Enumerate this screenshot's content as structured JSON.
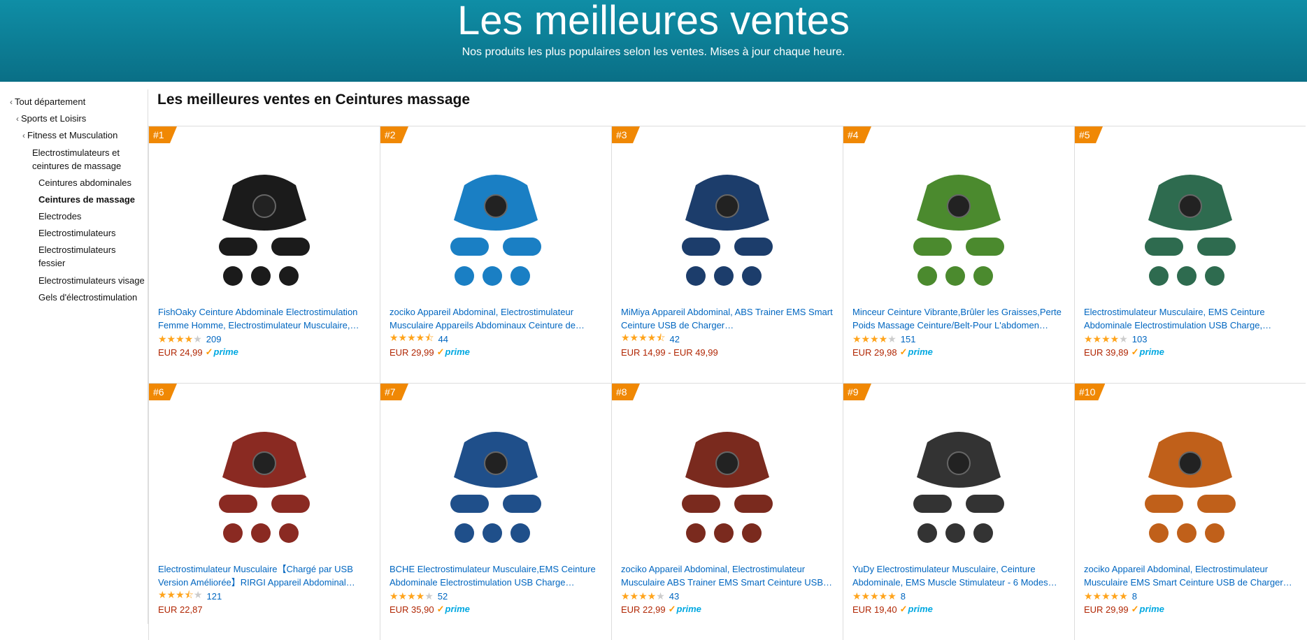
{
  "banner": {
    "title": "Les meilleures ventes",
    "subtitle": "Nos produits les plus populaires selon les ventes. Mises à jour chaque heure."
  },
  "sidebar": {
    "items": [
      {
        "label": "Tout département",
        "chevron": true,
        "bold": false
      },
      {
        "label": "Sports et Loisirs",
        "chevron": true,
        "bold": false
      },
      {
        "label": "Fitness et Musculation",
        "chevron": true,
        "bold": false
      },
      {
        "label": "Electrostimulateurs et ceintures de massage",
        "chevron": false,
        "bold": false
      },
      {
        "label": "Ceintures abdominales",
        "chevron": false,
        "bold": false
      },
      {
        "label": "Ceintures de massage",
        "chevron": false,
        "bold": true
      },
      {
        "label": "Electrodes",
        "chevron": false,
        "bold": false
      },
      {
        "label": "Electrostimulateurs",
        "chevron": false,
        "bold": false
      },
      {
        "label": "Electrostimulateurs fessier",
        "chevron": false,
        "bold": false
      },
      {
        "label": "Electrostimulateurs visage",
        "chevron": false,
        "bold": false
      },
      {
        "label": "Gels d'électrostimulation",
        "chevron": false,
        "bold": false
      }
    ]
  },
  "category_title": "Les meilleures ventes en Ceintures massage",
  "products": [
    {
      "rank": "#1",
      "title": "FishOaky Ceinture Abdominale Electrostimulation Femme Homme, Electrostimulateur Musculaire,…",
      "stars": 4,
      "reviews": "209",
      "price": "EUR 24,99",
      "prime": true,
      "thumb_color": "#1b1b1b"
    },
    {
      "rank": "#2",
      "title": "zociko Appareil Abdominal, Electrostimulateur Musculaire Appareils Abdominaux Ceinture de…",
      "stars": 4.5,
      "reviews": "44",
      "price": "EUR 29,99",
      "prime": true,
      "thumb_color": "#1a7fc4"
    },
    {
      "rank": "#3",
      "title": "MiMiya Appareil Abdominal, ABS Trainer EMS Smart Ceinture USB de Charger…",
      "stars": 4.5,
      "reviews": "42",
      "price": "EUR 14,99 - EUR 49,99",
      "prime": false,
      "thumb_color": "#1c3d6b"
    },
    {
      "rank": "#4",
      "title": "Minceur Ceinture Vibrante,Brûler les Graisses,Perte Poids Massage Ceinture/Belt-Pour L'abdomen…",
      "stars": 4,
      "reviews": "151",
      "price": "EUR 29,98",
      "prime": true,
      "thumb_color": "#4b8a2e"
    },
    {
      "rank": "#5",
      "title": "Electrostimulateur Musculaire, EMS Ceinture Abdominale Electrostimulation USB Charge,…",
      "stars": 4,
      "reviews": "103",
      "price": "EUR 39,89",
      "prime": true,
      "thumb_color": "#2e6b4f"
    },
    {
      "rank": "#6",
      "title": "Electrostimulateur Musculaire【Chargé par USB Version Améliorée】RIRGI Appareil Abdominal…",
      "stars": 3.5,
      "reviews": "121",
      "price": "EUR 22,87",
      "prime": false,
      "thumb_color": "#8a2a22"
    },
    {
      "rank": "#7",
      "title": "BCHE Electrostimulateur Musculaire,EMS Ceinture Abdominale Electrostimulation USB Charge…",
      "stars": 4,
      "reviews": "52",
      "price": "EUR 35,90",
      "prime": true,
      "thumb_color": "#1f4f8a"
    },
    {
      "rank": "#8",
      "title": "zociko Appareil Abdominal, Electrostimulateur Musculaire ABS Trainer EMS Smart Ceinture USB…",
      "stars": 4,
      "reviews": "43",
      "price": "EUR 22,99",
      "prime": true,
      "thumb_color": "#7a2a1e"
    },
    {
      "rank": "#9",
      "title": "YuDy Electrostimulateur Musculaire, Ceinture Abdominale, EMS Muscle Stimulateur - 6 Modes…",
      "stars": 5,
      "reviews": "8",
      "price": "EUR 19,40",
      "prime": true,
      "thumb_color": "#333333"
    },
    {
      "rank": "#10",
      "title": "zociko Appareil Abdominal, Electrostimulateur Musculaire EMS Smart Ceinture USB de Charger…",
      "stars": 5,
      "reviews": "8",
      "price": "EUR 29,99",
      "prime": true,
      "thumb_color": "#c0601a"
    }
  ],
  "prime_label": "prime",
  "colors": {
    "banner": "#0a7f97",
    "rank_badge": "#f08804",
    "link": "#0066c0",
    "price": "#b12704",
    "star": "#ffa41c"
  }
}
